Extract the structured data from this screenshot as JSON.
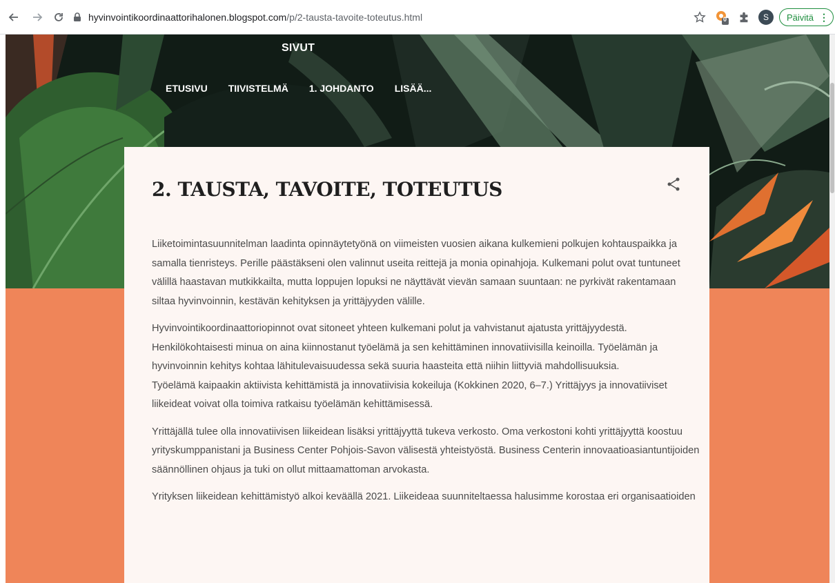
{
  "browser": {
    "url_host": "hyvinvointikoordinaattorihalonen.blogspot.com",
    "url_path": "/p/2-tausta-tavoite-toteutus.html",
    "avatar_letter": "S",
    "update_label": "Päivitä",
    "extension_badge": "0",
    "icons": [
      "back-icon",
      "forward-icon",
      "reload-icon",
      "lock-icon",
      "star-icon",
      "extension-icon",
      "puzzle-icon",
      "menu-dots-icon"
    ]
  },
  "blog": {
    "pages_label": "SIVUT",
    "nav": [
      "ETUSIVU",
      "TIIVISTELMÄ",
      "1. JOHDANTO",
      "LISÄÄ..."
    ]
  },
  "post": {
    "title": "2. TAUSTA, TAVOITE, TOTEUTUS",
    "paragraphs": [
      [
        "Liiketoimintasuunnitelman laadinta opinnäytetyönä on viimeisten vuosien aikana kulkemieni polkujen kohtauspaikka ja",
        "samalla tienristeys. Perille päästäkseni olen valinnut useita reittejä ja monia opinahjoja. Kulkemani polut ovat tuntuneet",
        "välillä haastavan mutkikkailta, mutta loppujen lopuksi ne näyttävät vievän samaan suuntaan: ne pyrkivät rakentamaan",
        "siltaa hyvinvoinnin, kestävän kehityksen ja yrittäjyyden välille."
      ],
      [
        "Hyvinvointikoordinaattoriopinnot ovat sitoneet yhteen kulkemani polut ja vahvistanut ajatusta yrittäjyydestä.",
        "Henkilökohtaisesti minua on aina kiinnostanut työelämä ja sen kehittäminen innovatiivisilla keinoilla. Työelämän ja",
        "hyvinvoinnin kehitys kohtaa lähitulevaisuudessa sekä suuria haasteita että niihin liittyviä mahdollisuuksia.",
        "Työelämä kaipaakin aktiivista kehittämistä ja innovatiivisia kokeiluja (Kokkinen 2020, 6–7.) Yrittäjyys ja innovatiiviset",
        "liikeideat voivat olla toimiva ratkaisu työelämän kehittämisessä."
      ],
      [
        "Yrittäjällä tulee olla innovatiivisen liikeidean lisäksi yrittäjyyttä tukeva verkosto. Oma verkostoni kohti yrittäjyyttä koostuu",
        "yrityskumppanistani ja Business Center Pohjois-Savon välisestä yhteistyöstä. Business Centerin innovaatioasiantuntijoiden",
        "säännöllinen ohjaus ja tuki on ollut mittaamattoman arvokasta."
      ],
      [
        "Yrityksen liikeidean kehittämistyö alkoi keväällä 2021. Liikeideaa suunniteltaessa halusimme korostaa eri organisaatioiden"
      ]
    ]
  },
  "colors": {
    "accent_orange": "#ef8559",
    "card_bg": "#fdf6f3",
    "update_green": "#1e8e3e"
  }
}
